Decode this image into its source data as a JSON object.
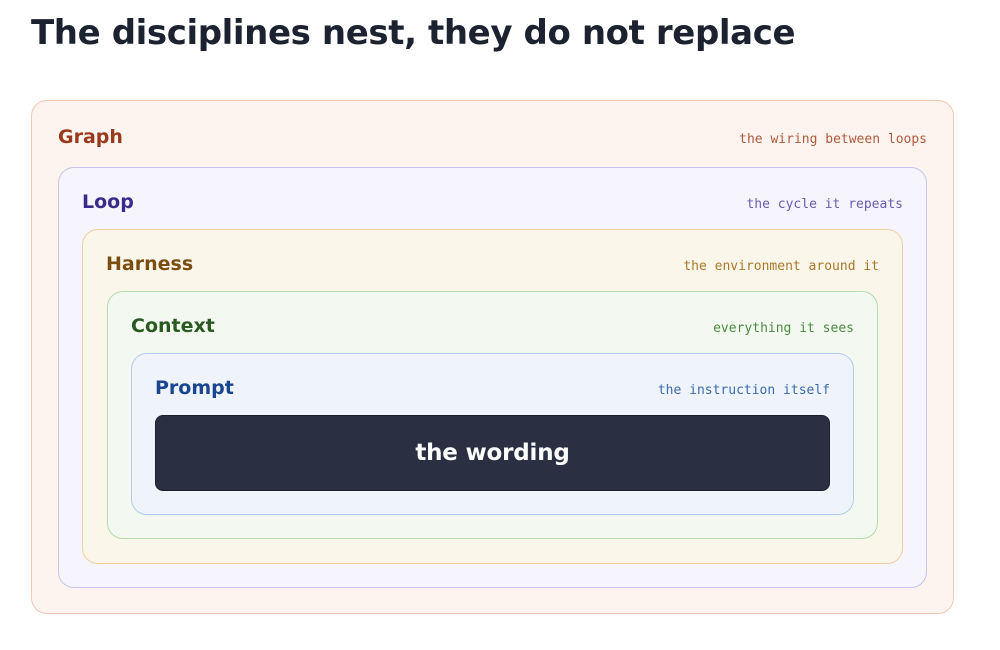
{
  "title": "The disciplines nest, they do not replace",
  "layers": [
    {
      "name": "Graph",
      "description": "the wiring between loops",
      "colors": {
        "border": "#f0c8b4",
        "background": "#fdf4f0",
        "name": "#9a3a1c",
        "description": "#b05a3c"
      }
    },
    {
      "name": "Loop",
      "description": "the cycle it repeats",
      "colors": {
        "border": "#c8c4ec",
        "background": "#f6f5fd",
        "name": "#3a2a8c",
        "description": "#6a5cb0"
      }
    },
    {
      "name": "Harness",
      "description": "the environment around it",
      "colors": {
        "border": "#ecd0a2",
        "background": "#fbf6ea",
        "name": "#7a4e10",
        "description": "#a8782a"
      }
    },
    {
      "name": "Context",
      "description": "everything it sees",
      "colors": {
        "border": "#b4dcae",
        "background": "#f3f8f0",
        "name": "#2a5a22",
        "description": "#4c8a44"
      }
    },
    {
      "name": "Prompt",
      "description": "the instruction itself",
      "colors": {
        "border": "#b2cdec",
        "background": "#eff4fc",
        "name": "#1a4690",
        "description": "#3e6aaa"
      }
    }
  ],
  "core": {
    "label": "the wording",
    "colors": {
      "background": "#2a3042",
      "text": "#ffffff"
    }
  }
}
